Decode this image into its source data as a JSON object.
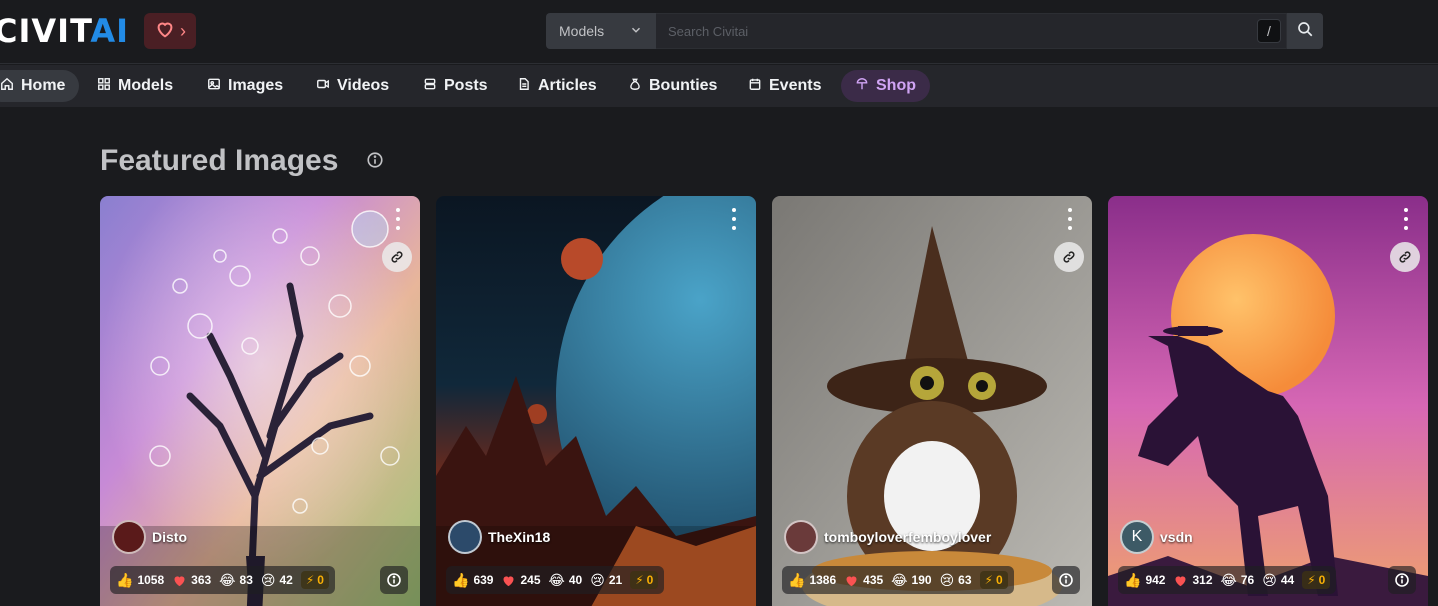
{
  "header": {
    "logo_main": "CIVIT",
    "logo_accent": "AI",
    "support_chevron": "›",
    "search": {
      "category": "Models",
      "placeholder": "Search Civitai",
      "shortcut": "/"
    }
  },
  "nav": {
    "items": [
      {
        "label": "Home",
        "icon": "home-icon"
      },
      {
        "label": "Models",
        "icon": "grid-icon"
      },
      {
        "label": "Images",
        "icon": "image-icon"
      },
      {
        "label": "Videos",
        "icon": "video-icon"
      },
      {
        "label": "Posts",
        "icon": "posts-icon"
      },
      {
        "label": "Articles",
        "icon": "article-icon"
      },
      {
        "label": "Bounties",
        "icon": "moneybag-icon"
      },
      {
        "label": "Events",
        "icon": "calendar-icon"
      },
      {
        "label": "Shop",
        "icon": "shop-icon"
      }
    ],
    "active": "Home"
  },
  "section": {
    "title": "Featured Images"
  },
  "cards": [
    {
      "user": "Disto",
      "likes": "1058",
      "hearts": "363",
      "laughs": "83",
      "cries": "42",
      "tips": "0",
      "has_remix": true
    },
    {
      "user": "TheXin18",
      "likes": "639",
      "hearts": "245",
      "laughs": "40",
      "cries": "21",
      "tips": "0",
      "has_remix": false
    },
    {
      "user": "tomboyloverfemboylover",
      "likes": "1386",
      "hearts": "435",
      "laughs": "190",
      "cries": "63",
      "tips": "0",
      "has_remix": true
    },
    {
      "user": "vsdn",
      "avatar_letter": "K",
      "likes": "942",
      "hearts": "312",
      "laughs": "76",
      "cries": "44",
      "tips": "0",
      "has_remix": true
    }
  ],
  "colors": {
    "background": "#1a1b1e",
    "nav_bg": "#25262b",
    "accent_blue": "#228be6",
    "shop_purple": "#d0a4f4",
    "heart_red": "#fa5252",
    "tip_yellow": "#fab005"
  }
}
